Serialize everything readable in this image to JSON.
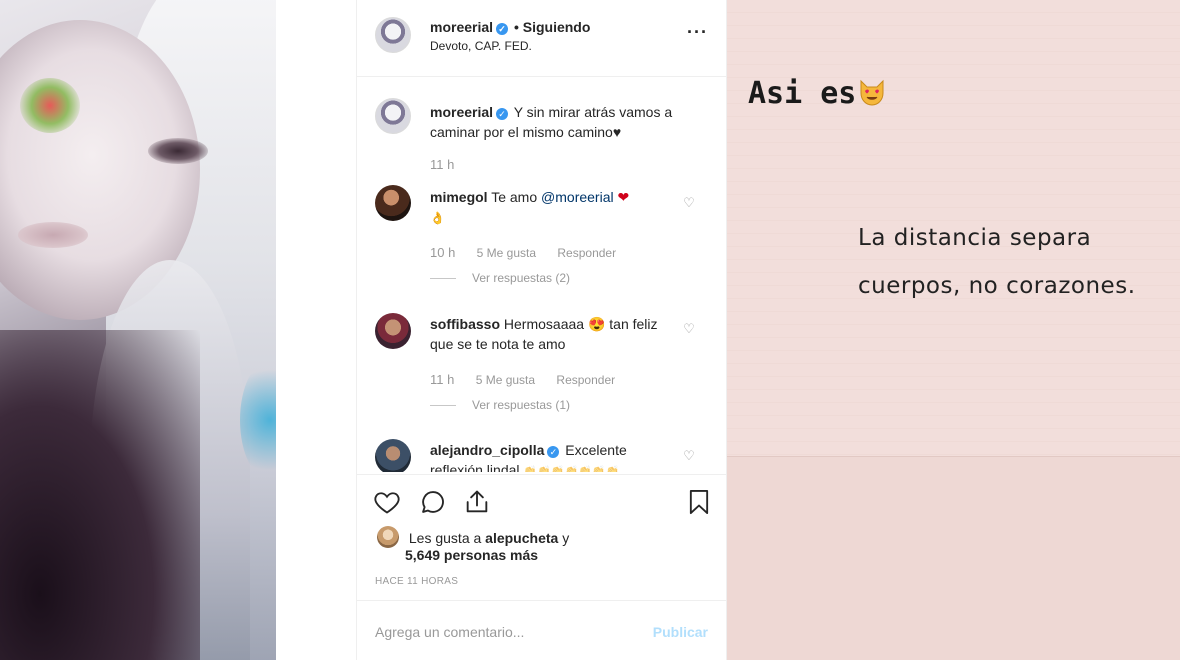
{
  "post": {
    "username": "moreerial",
    "verified_mark": "✓",
    "separator": "•",
    "follow_status": "Siguiendo",
    "location": "Devoto, CAP. FED.",
    "more_icon": "more-options-icon"
  },
  "caption": {
    "username": "moreerial",
    "text": "Y sin mirar atrás vamos a caminar por el mismo camino♥",
    "time": "11 h"
  },
  "comments": [
    {
      "username": "mimegol",
      "text": "Te amo",
      "mention": "@moreerial",
      "emoji": "❤",
      "emoji2": "👌",
      "time": "10 h",
      "likes": "5 Me gusta",
      "reply": "Responder",
      "view_replies": "Ver respuestas (2)"
    },
    {
      "username": "soffibasso",
      "text": "Hermosaaaa",
      "emoji": "😍",
      "text2": "tan feliz que se te nota te amo",
      "time": "11 h",
      "likes": "5 Me gusta",
      "reply": "Responder",
      "view_replies": "Ver respuestas (1)"
    },
    {
      "username": "alejandro_cipolla",
      "text": "Excelente reflexión lindal",
      "emojis": "👏👏👏👏👏👏👏"
    }
  ],
  "likes": {
    "prefix": "Les gusta a",
    "user": "alepucheta",
    "suffix": "y",
    "others": "5,649 personas más"
  },
  "timestamp": "HACE 11 HORAS",
  "composer": {
    "placeholder": "Agrega un comentario...",
    "publish": "Publicar"
  },
  "story": {
    "title": "Asi es",
    "title_emoji": "😻",
    "quote_line1": "La distancia separa",
    "quote_line2": "cuerpos, no corazones."
  },
  "colors": {
    "link": "#003569",
    "verified": "#3897f0",
    "publish_disabled": "#b2dffc",
    "story_bg": "#f2dedb"
  }
}
